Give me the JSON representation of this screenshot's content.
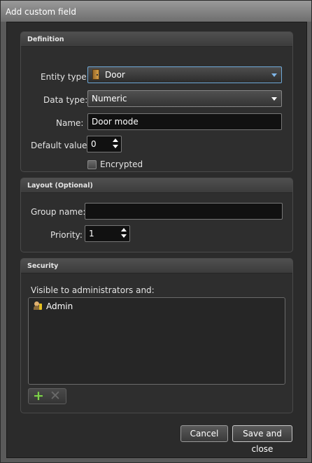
{
  "window": {
    "title": "Add custom field"
  },
  "definition": {
    "header": "Definition",
    "entity_type": {
      "label": "Entity type:",
      "value": "Door",
      "icon": "door-icon"
    },
    "data_type": {
      "label": "Data type:",
      "value": "Numeric"
    },
    "name": {
      "label": "Name:",
      "value": "Door mode"
    },
    "default_value": {
      "label": "Default value:",
      "value": "0"
    },
    "encrypted": {
      "label": "Encrypted",
      "checked": false
    }
  },
  "layout": {
    "header": "Layout (Optional)",
    "group_name": {
      "label": "Group name:",
      "value": ""
    },
    "priority": {
      "label": "Priority:",
      "value": "1"
    }
  },
  "security": {
    "header": "Security",
    "visible_label": "Visible to administrators and:",
    "items": [
      {
        "label": "Admin",
        "icon": "user-key-icon"
      }
    ],
    "toolbar": {
      "add_icon": "plus-icon",
      "remove_icon": "cross-icon"
    }
  },
  "footer": {
    "cancel_label": "Cancel",
    "save_label": "Save and close"
  }
}
